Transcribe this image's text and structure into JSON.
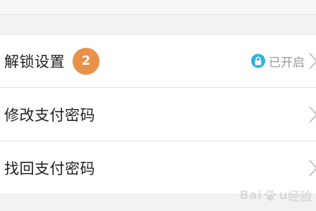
{
  "settings": {
    "rows": [
      {
        "label": "解锁设置",
        "step_badge": "2",
        "status_text": "已开启",
        "status_icon": "lock-icon",
        "chevron_icon": "chevron-right-icon"
      },
      {
        "label": "修改支付密码",
        "chevron_icon": "chevron-right-icon"
      },
      {
        "label": "找回支付密码",
        "chevron_icon": "chevron-right-icon"
      }
    ]
  },
  "watermark": {
    "brand": "Bai",
    "brand_tail": "u",
    "sub": "经验"
  },
  "colors": {
    "badge": "#e89148",
    "lock_badge": "#2db3e0",
    "label_text": "#1f1f1f",
    "status_text": "#9a9a9a",
    "chevron": "#c4c4c4",
    "background": "#f2f2f2"
  }
}
